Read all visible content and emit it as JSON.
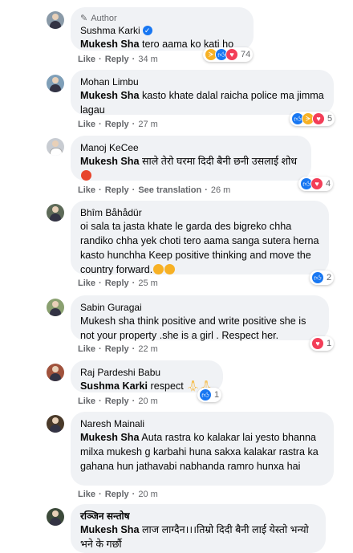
{
  "comments": [
    {
      "badge": "Author",
      "name": "Sushma Karki",
      "verified": true,
      "mention": "Mukesh Sha",
      "text": " tero aama ko kati ho",
      "actions": {
        "like": "Like",
        "reply": "Reply",
        "time": "34 m"
      },
      "reaction_count": "74"
    },
    {
      "name": "Mohan Limbu",
      "mention": "Mukesh Sha",
      "text": " kasto khate dalal raicha police ma jimma lagau",
      "actions": {
        "like": "Like",
        "reply": "Reply",
        "time": "27 m"
      },
      "reaction_count": "5"
    },
    {
      "name": "Manoj KeCee",
      "mention": "Mukesh Sha",
      "text": " साले तेरो घरमा दिदी बैनी छनी उसलाई शोध",
      "actions": {
        "like": "Like",
        "reply": "Reply",
        "see_translation": "See translation",
        "time": "26 m"
      },
      "reaction_count": "4"
    },
    {
      "name": "Bhîm Båhådür",
      "text": "oi sala ta jasta khate le garda des bigreko chha randiko chha yek choti tero aama sanga sutera herna kasto hunchha Keep positive thinking and move the country forward.",
      "actions": {
        "like": "Like",
        "reply": "Reply",
        "time": "25 m"
      },
      "reaction_count": "2"
    },
    {
      "name": "Sabin Guragai",
      "text": "Mukesh sha think positive and write positive she is not your property .she is a girl . Respect her.",
      "actions": {
        "like": "Like",
        "reply": "Reply",
        "time": "22 m"
      },
      "reaction_count": "1"
    },
    {
      "name": "Raj Pardeshi Babu",
      "mention": "Sushma Karki",
      "text": " respect ",
      "actions": {
        "like": "Like",
        "reply": "Reply",
        "time": "20 m"
      },
      "reaction_count": "1"
    },
    {
      "name": "Naresh Mainali",
      "mention": "Mukesh Sha",
      "text": " Auta rastra ko kalakar lai yesto bhanna milxa mukesh g karbahi huna sakxa kalakar rastra ka gahana hun jathavabi nabhanda ramro hunxa hai",
      "actions": {
        "like": "Like",
        "reply": "Reply",
        "time": "20 m"
      }
    },
    {
      "name": "रञ्जिन सन्तोष",
      "mention": "Mukesh Sha",
      "text": " लाज लाग्दैन।।।तिम्रो दिदी बैनी लाई येस्तो भन्यो भने के गर्छौ"
    }
  ],
  "colors": {
    "like": "#1877f2",
    "love": "#f33e58",
    "haha": "#f7b125",
    "bubble": "#f0f2f5",
    "secondary_text": "#65676b"
  },
  "icons": {
    "author": "pencil-icon",
    "verified": "verified-check-icon",
    "reactions": [
      "haha-icon",
      "like-icon",
      "love-icon",
      "sad-icon"
    ],
    "emoji": [
      "angry-face-emoji",
      "crying-face-emoji",
      "folded-hands-emoji"
    ]
  }
}
